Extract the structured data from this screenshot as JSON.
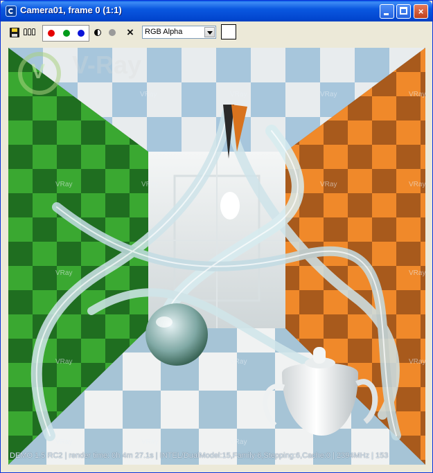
{
  "window": {
    "title": "Camera01, frame 0 (1:1)",
    "icon": "3dsmax-app-icon",
    "controls": {
      "minimize": "minimize-icon",
      "maximize": "maximize-icon",
      "close": "×"
    }
  },
  "toolbar": {
    "save_icon": "save-icon",
    "clone_icon": "clone-icon",
    "channels": {
      "red": "#e50000",
      "green": "#009b1a",
      "blue": "#0b14d8"
    },
    "mono_icon": "monochrome-icon",
    "gray_icon": "gray-channel-icon",
    "clear": "×",
    "channel_select": "RGB Alpha",
    "swatch_color": "#ffffff"
  },
  "render": {
    "watermark_logo": "V-Ray",
    "watermark_text": "VRay",
    "status": "DEMO 1.5 RC2 | render time: 0h 4m 27.1s | INTEL/DualModel:15,Family:6,Stepping:6,Cache:0 | 2394MHz | 153",
    "colors": {
      "left_wall": "#2f9a2a",
      "right_wall": "#e07a1c",
      "floor_light": "#e9eeee",
      "floor_dark": "#9fc2d8"
    }
  }
}
